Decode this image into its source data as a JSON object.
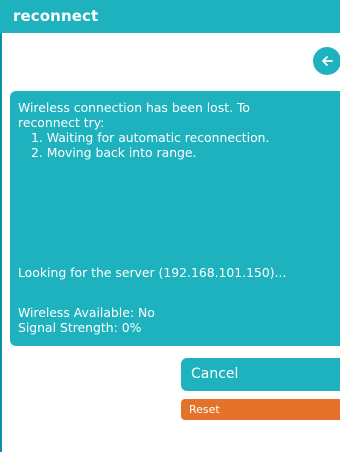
{
  "window": {
    "title": "reconnect"
  },
  "message": {
    "lines": [
      "Wireless connection has been lost. To",
      "reconnect try:",
      "1. Waiting for automatic reconnection.",
      "2. Moving back into range."
    ],
    "server_status": "Looking for the server (192.168.101.150)...",
    "wireless_available": "Wireless Available: No",
    "signal_strength": "Signal Strength: 0%"
  },
  "buttons": {
    "back_icon": "arrow-left-icon",
    "cancel_label": "Cancel",
    "reset_label": "Reset"
  },
  "colors": {
    "accent": "#1eb2bf",
    "reset": "#e4722a",
    "text_on_accent": "#ffffff"
  }
}
